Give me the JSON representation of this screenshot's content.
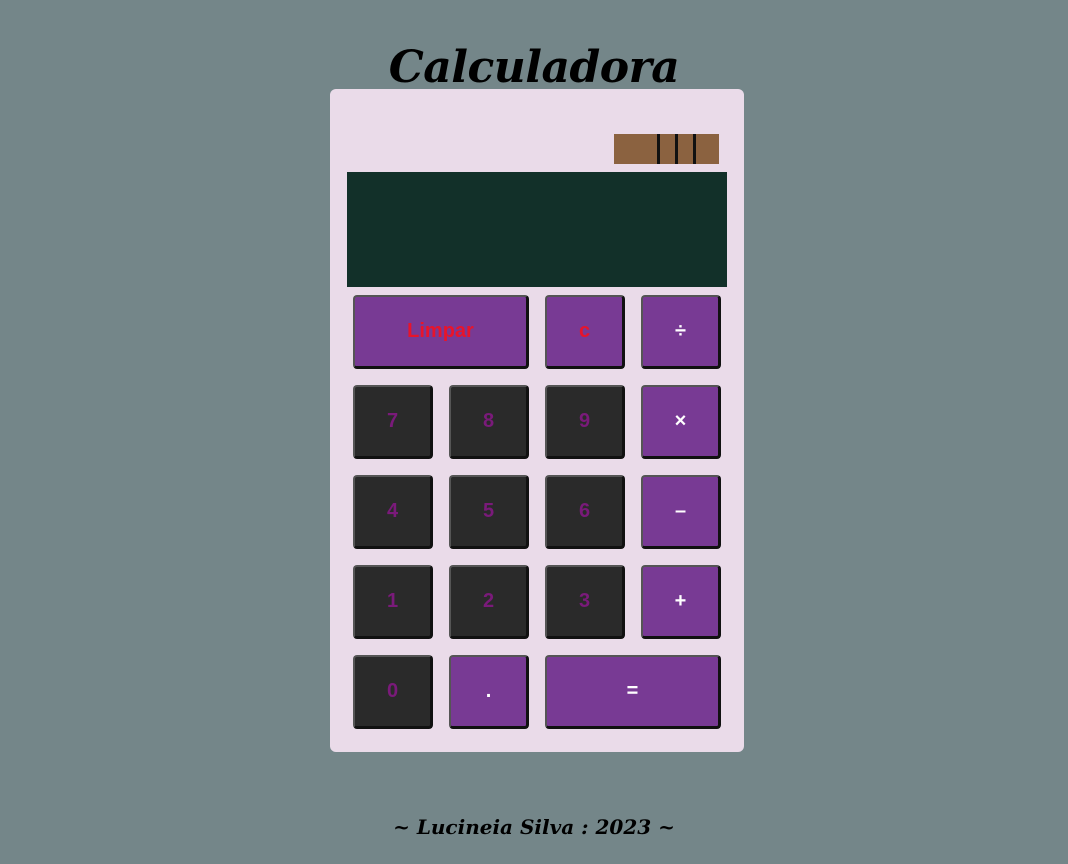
{
  "page": {
    "title": "Calculadora",
    "footer": "~ Lucineia Silva : 2023 ~"
  },
  "display": {
    "value": ""
  },
  "buttons": {
    "clear_all": "Limpar",
    "clear_entry": "c",
    "divide": "÷",
    "multiply": "×",
    "subtract": "–",
    "add": "+",
    "equals": "=",
    "decimal": ".",
    "d0": "0",
    "d1": "1",
    "d2": "2",
    "d3": "3",
    "d4": "4",
    "d5": "5",
    "d6": "6",
    "d7": "7",
    "d8": "8",
    "d9": "9"
  },
  "colors": {
    "background": "#748689",
    "calculator_body": "#eadbe9",
    "display": "#123029",
    "solar_panel": "#8b6240",
    "number_key": "#2a2a2a",
    "number_key_text": "#7a1a7a",
    "operator_key": "#783a94",
    "operator_key_text": "#ffffff",
    "clear_key_text": "#e8142b"
  }
}
